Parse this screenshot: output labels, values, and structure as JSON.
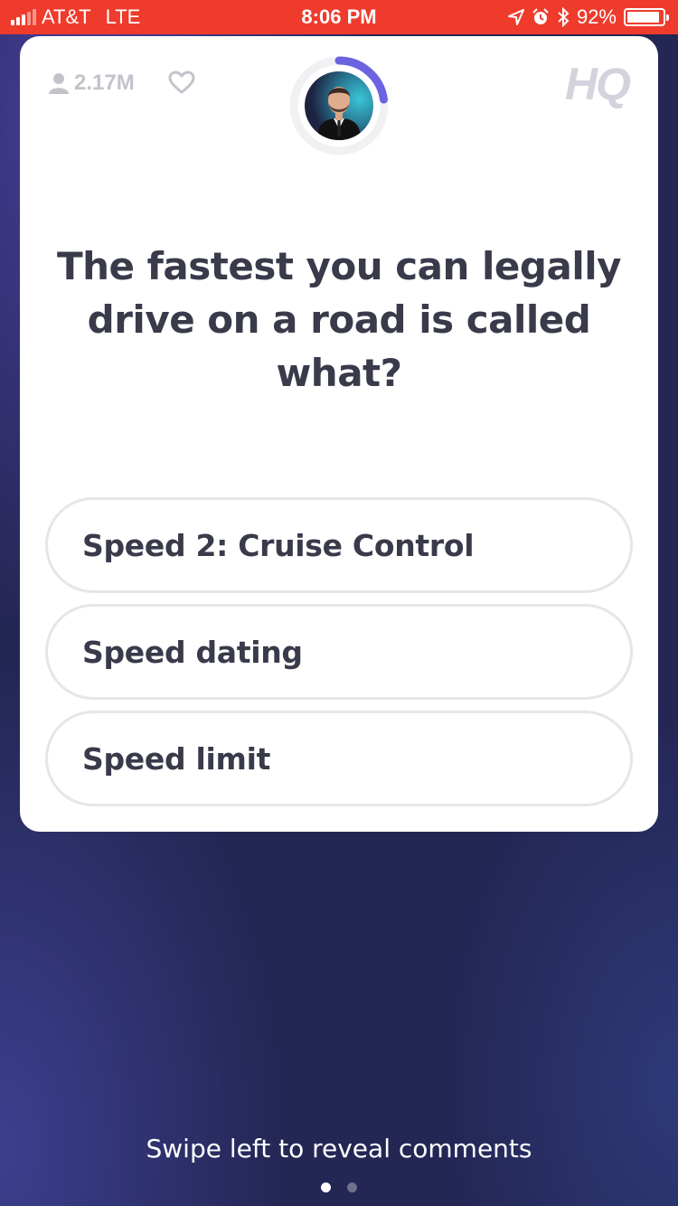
{
  "status_bar": {
    "carrier": "AT&T",
    "network": "LTE",
    "time": "8:06 PM",
    "battery_percent": "92%",
    "battery_level": 0.92,
    "icons": [
      "signal-icon",
      "location-arrow-icon",
      "alarm-clock-icon",
      "bluetooth-icon",
      "battery-icon"
    ],
    "background_color": "#ef3b2c"
  },
  "game_card": {
    "viewer_count": "2.17M",
    "brand_logo": "HQ",
    "timer_ring_color": "#6b63e0",
    "question": "The fastest you can legally drive on a road is called what?",
    "answers": [
      {
        "label": "Speed 2: Cruise Control"
      },
      {
        "label": "Speed dating"
      },
      {
        "label": "Speed limit"
      }
    ]
  },
  "footer": {
    "hint": "Swipe left to reveal comments",
    "pages": 2,
    "active_page": 1
  },
  "colors": {
    "background": "#242654",
    "card": "#ffffff",
    "text": "#393a4a",
    "muted": "#c3c3cc"
  }
}
